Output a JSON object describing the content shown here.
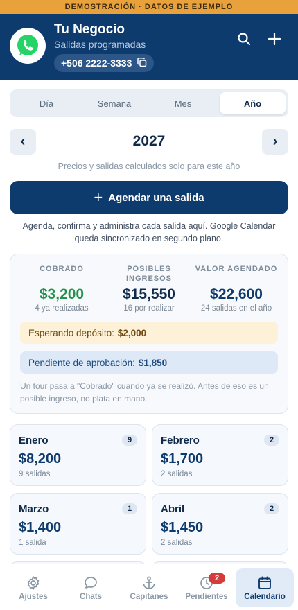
{
  "banner": "DEMOSTRACIÓN · DATOS DE EJEMPLO",
  "header": {
    "name": "Tu Negocio",
    "subtitle": "Salidas programadas",
    "phone": "+506 2222-3333"
  },
  "segments": [
    "Día",
    "Semana",
    "Mes",
    "Año"
  ],
  "active_segment": "Año",
  "year_nav": {
    "prev": "‹",
    "year": "2027",
    "next": "›",
    "note": "Precios y salidas calculados solo para este año"
  },
  "cta": {
    "label": "Agendar una salida",
    "description": "Agenda, confirma y administra cada salida aquí. Google Calendar queda sincronizado en segundo plano."
  },
  "summary": {
    "collected": {
      "label": "COBRADO",
      "value": "$3,200",
      "sub": "4 ya realizadas"
    },
    "possible": {
      "label": "POSIBLES INGRESOS",
      "value": "$15,550",
      "sub": "16 por realizar"
    },
    "scheduled": {
      "label": "VALOR AGENDADO",
      "value": "$22,600",
      "sub": "24 salidas en el año"
    },
    "deposit_label": "Esperando depósito:",
    "deposit_value": "$2,000",
    "approval_label": "Pendiente de aprobación:",
    "approval_value": "$1,850",
    "note": "Un tour pasa a \"Cobrado\" cuando ya se realizó. Antes de eso es un posible ingreso, no plata en mano."
  },
  "months": [
    {
      "name": "Enero",
      "badge": "9",
      "amount": "$8,200",
      "count": "9 salidas"
    },
    {
      "name": "Febrero",
      "badge": "2",
      "amount": "$1,700",
      "count": "2 salidas"
    },
    {
      "name": "Marzo",
      "badge": "1",
      "amount": "$1,400",
      "count": "1 salida"
    },
    {
      "name": "Abril",
      "badge": "2",
      "amount": "$1,450",
      "count": "2 salidas"
    }
  ],
  "tabs": [
    {
      "label": "Ajustes",
      "icon": "gear-icon"
    },
    {
      "label": "Chats",
      "icon": "chat-icon"
    },
    {
      "label": "Capitanes",
      "icon": "anchor-icon"
    },
    {
      "label": "Pendientes",
      "icon": "clock-icon",
      "badge": "2"
    },
    {
      "label": "Calendario",
      "icon": "calendar-icon"
    }
  ],
  "colors": {
    "primary": "#0e3b6e",
    "banner": "#e9a13b",
    "green": "#24924e",
    "badge_red": "#d63b3b",
    "whatsapp": "#25d366"
  }
}
